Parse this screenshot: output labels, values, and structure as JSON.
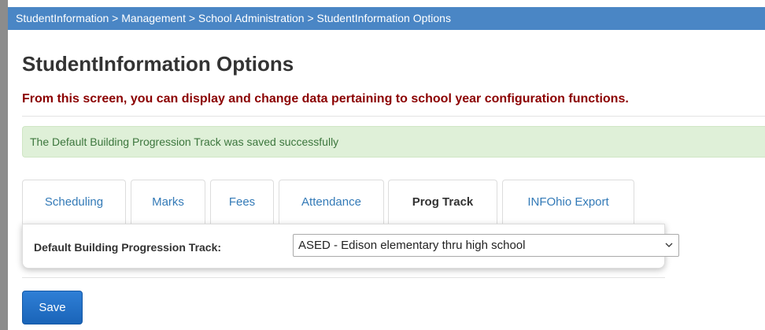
{
  "breadcrumb": "StudentInformation > Management > School Administration > StudentInformation Options",
  "page": {
    "title": "StudentInformation Options",
    "subtitle": "From this screen, you can display and change data pertaining to school year configuration functions."
  },
  "alert": {
    "message": "The Default Building Progression Track was saved successfully"
  },
  "tabs": [
    {
      "label": "Scheduling"
    },
    {
      "label": "Marks"
    },
    {
      "label": "Fees"
    },
    {
      "label": "Attendance"
    },
    {
      "label": "Prog Track",
      "active": true
    },
    {
      "label": "INFOhio Export"
    }
  ],
  "form": {
    "track_label": "Default Building Progression Track:",
    "track_value": "ASED - Edison elementary thru high school"
  },
  "buttons": {
    "save": "Save"
  },
  "colors": {
    "breadcrumb_bg": "#4a86c5",
    "subtitle": "#8b0000",
    "alert_bg": "#dff0d8",
    "alert_text": "#3c763d",
    "tab_link": "#337ab7",
    "save_button": "#1a64b8"
  },
  "icons": {
    "select_arrow": "chevron-down-icon"
  }
}
